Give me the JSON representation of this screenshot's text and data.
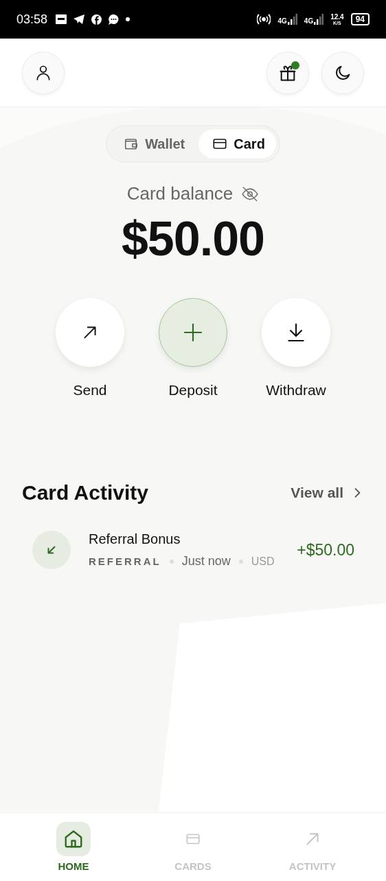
{
  "status_bar": {
    "time": "03:58",
    "network_1": "4G",
    "network_2": "4G",
    "speed": "12.4",
    "speed_unit": "K/S",
    "battery": "94"
  },
  "header": {
    "gift_badge": true
  },
  "balance_tabs": [
    {
      "label": "Wallet",
      "kind": "wallet",
      "selected": false
    },
    {
      "label": "Card",
      "kind": "card",
      "selected": true
    }
  ],
  "balance": {
    "label": "Card balance",
    "amount": "$50.00"
  },
  "actions": [
    {
      "label": "Send",
      "kind": "send",
      "primary": false
    },
    {
      "label": "Deposit",
      "kind": "deposit",
      "primary": true
    },
    {
      "label": "Withdraw",
      "kind": "withdraw",
      "primary": false
    }
  ],
  "activity": {
    "title": "Card Activity",
    "view_all": "View all",
    "items": [
      {
        "title": "Referral Bonus",
        "category": "REFERRAL",
        "time": "Just now",
        "currency": "USD",
        "amount": "+$50.00",
        "kind": "incoming"
      }
    ]
  },
  "bottom_nav": [
    {
      "label": "HOME",
      "kind": "home",
      "selected": true
    },
    {
      "label": "CARDS",
      "kind": "cards",
      "selected": false
    },
    {
      "label": "ACTIVITY",
      "kind": "activity",
      "selected": false
    }
  ]
}
